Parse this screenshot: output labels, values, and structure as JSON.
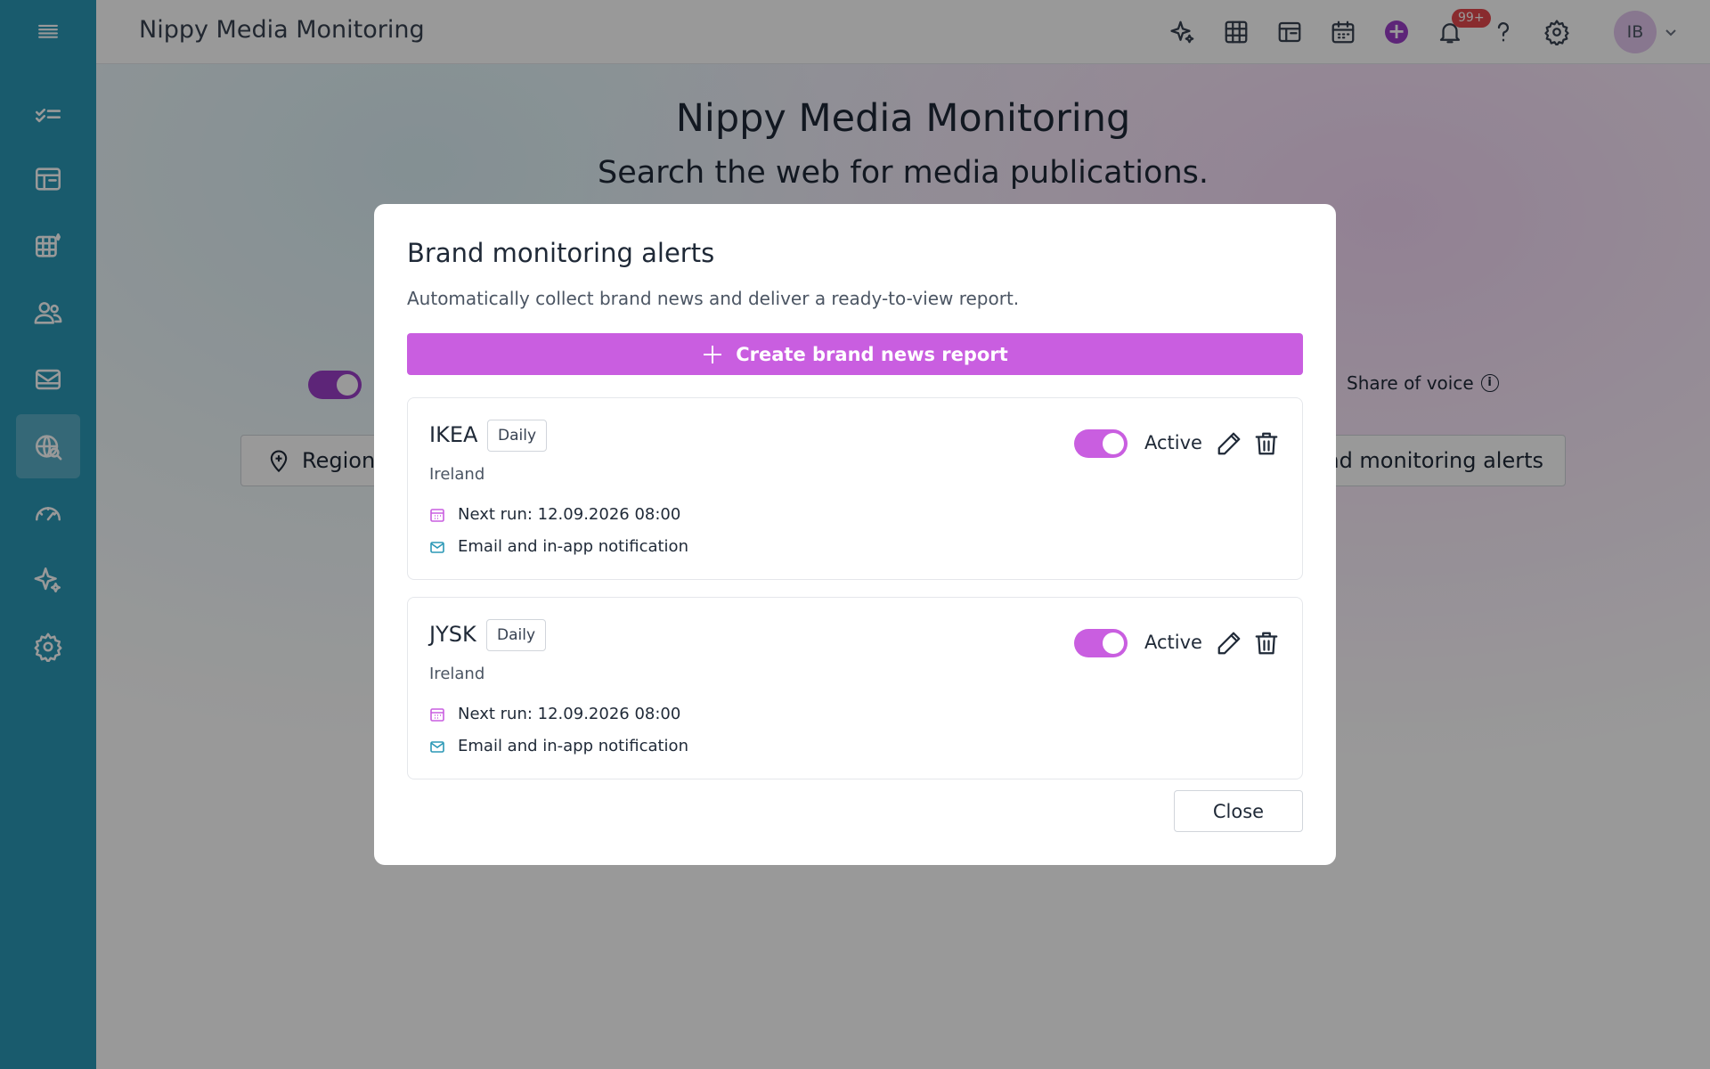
{
  "app": {
    "title": "Nippy Media Monitoring"
  },
  "sidebar": {
    "items": [
      {
        "icon": "menu-icon"
      },
      {
        "icon": "checklist-icon"
      },
      {
        "icon": "dashboard-icon"
      },
      {
        "icon": "table-icon"
      },
      {
        "icon": "users-icon"
      },
      {
        "icon": "mail-icon"
      },
      {
        "icon": "globe-search-icon",
        "active": true
      },
      {
        "icon": "gauge-icon"
      },
      {
        "icon": "sparkle-icon"
      },
      {
        "icon": "gear-icon"
      }
    ]
  },
  "header": {
    "icons": [
      "sparkle-icon",
      "table-icon",
      "dashboard-icon",
      "calendar-icon",
      "add-icon",
      "bell-icon",
      "help-icon",
      "gear-icon"
    ],
    "notification_badge": "99+",
    "avatar_initials": "IB"
  },
  "main": {
    "hero_title": "Nippy Media Monitoring",
    "hero_subtitle": "Search the web for media publications.",
    "share_of_voice_label": "Share of voice",
    "region_label": "Region",
    "alerts_button_label": "Brand monitoring alerts"
  },
  "modal": {
    "title": "Brand monitoring alerts",
    "description": "Automatically collect brand news and deliver a ready-to-view report.",
    "create_label": "Create brand news report",
    "close_label": "Close",
    "alerts": [
      {
        "name": "IKEA",
        "frequency": "Daily",
        "region": "Ireland",
        "status": "Active",
        "enabled": true,
        "next_run": "Next run: 12.09.2026 08:00",
        "notification": "Email and in-app notification"
      },
      {
        "name": "JYSK",
        "frequency": "Daily",
        "region": "Ireland",
        "status": "Active",
        "enabled": true,
        "next_run": "Next run: 12.09.2026 08:00",
        "notification": "Email and in-app notification"
      }
    ]
  },
  "colors": {
    "sidebar": "#2b98b6",
    "accent": "#c95ee0",
    "brand_purple": "#9b3fc9",
    "badge": "#e5484d"
  }
}
